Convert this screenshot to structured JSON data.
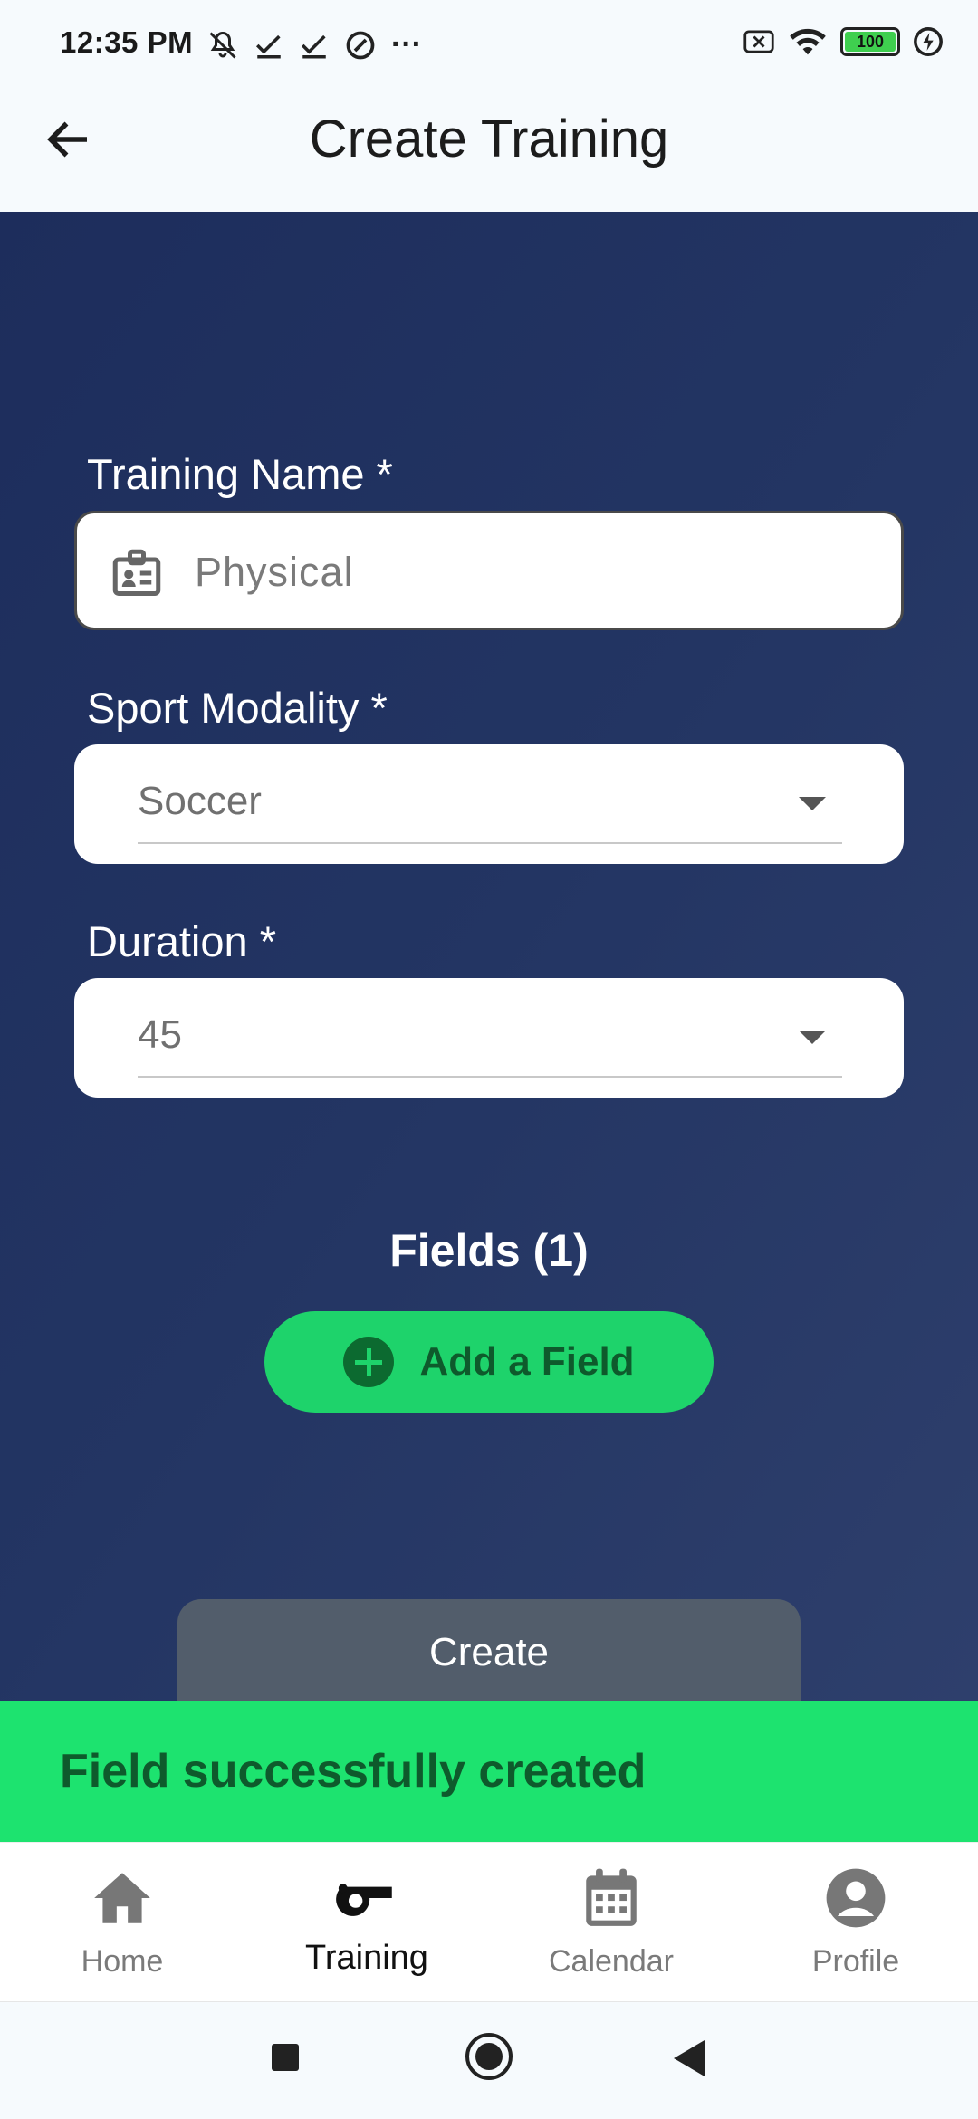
{
  "status_bar": {
    "time": "12:35 PM",
    "battery": "100",
    "overflow": "···"
  },
  "app_bar": {
    "title": "Create Training"
  },
  "form": {
    "training_name": {
      "label": "Training Name *",
      "placeholder": "Physical",
      "value": ""
    },
    "sport_modality": {
      "label": "Sport Modality *",
      "value": "Soccer"
    },
    "duration": {
      "label": "Duration *",
      "value": "45"
    },
    "fields_heading": "Fields (1)",
    "add_field_label": "Add a Field",
    "create_label": "Create"
  },
  "snackbar": {
    "message": "Field successfully created",
    "color": "#1de36f"
  },
  "bottom_nav": {
    "items": [
      {
        "label": "Home",
        "icon": "home-icon"
      },
      {
        "label": "Training",
        "icon": "whistle-icon",
        "active": true
      },
      {
        "label": "Calendar",
        "icon": "calendar-icon"
      },
      {
        "label": "Profile",
        "icon": "profile-icon"
      }
    ]
  },
  "colors": {
    "background_gradient_start": "#1d2d5c",
    "accent_green": "#1ed36b",
    "create_button": "#525d6b"
  }
}
